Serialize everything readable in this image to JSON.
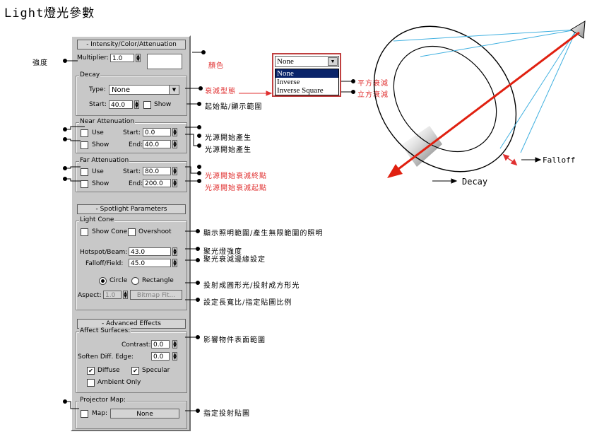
{
  "title": "Light燈光參數",
  "intensity": {
    "rollout": "- Intensity/Color/Attenuation",
    "multiplier_label": "Multiplier:",
    "multiplier_value": "1.0",
    "decay_group": "Decay",
    "type_label": "Type:",
    "type_value": "None",
    "start_label": "Start:",
    "start_value": "40.0",
    "show_label": "Show",
    "near_group": "Near Attenuation",
    "near_use": "Use",
    "near_show": "Show",
    "near_start_label": "Start:",
    "near_start_value": "0.0",
    "near_end_label": "End:",
    "near_end_value": "40.0",
    "far_group": "Far Attenuation",
    "far_use": "Use",
    "far_show": "Show",
    "far_start_label": "Start:",
    "far_start_value": "80.0",
    "far_end_label": "End:",
    "far_end_value": "200.0"
  },
  "spotlight": {
    "rollout": "-    Spotlight Parameters",
    "cone_group": "Light Cone",
    "show_cone": "Show Cone",
    "overshoot": "Overshoot",
    "hotspot_label": "Hotspot/Beam:",
    "hotspot_value": "43.0",
    "falloff_label": "Falloff/Field:",
    "falloff_value": "45.0",
    "circle": "Circle",
    "rectangle": "Rectangle",
    "aspect_label": "Aspect:",
    "aspect_value": "1.0",
    "bitmap_fit": "Bitmap Fit..."
  },
  "advanced": {
    "rollout": "-      Advanced Effects",
    "affect_group": "Affect Surfaces:",
    "contrast_label": "Contrast:",
    "contrast_value": "0.0",
    "soften_label": "Soften Diff. Edge:",
    "soften_value": "0.0",
    "diffuse": "Diffuse",
    "specular": "Specular",
    "ambient_only": "Ambient Only",
    "projector_group": "Projector Map:",
    "map_label": "Map:",
    "map_value": "None"
  },
  "dropdown_popup": {
    "selected": "None",
    "options": [
      "None",
      "Inverse",
      "Inverse Square"
    ]
  },
  "annotations": {
    "intensity": "強度",
    "color": "顏色",
    "decay_type": "衰減型態",
    "square_decay": "平方衰減",
    "cube_decay": "立方衰減",
    "start_show": "起始點/顯示範圍",
    "near_1": "光源開始產生",
    "near_2": "光源開始產生",
    "far_1": "光源開始衰減終點",
    "far_2": "光源開始衰減起點",
    "show_cone": "顯示照明範圍/產生無限範圍的照明",
    "hotspot": "聚光燈強度",
    "falloff": "聚光衰減邊緣設定",
    "circle_rect": "投射成圓形光/投射成方形光",
    "aspect": "設定長寬比/指定貼圖比例",
    "affect": "影響物件表面範圍",
    "projector": "指定投射貼圖"
  },
  "diagram": {
    "falloff_label": "Falloff",
    "decay_label": "Decay",
    "colors": {
      "cone": "#40b0e0",
      "arrow": "#e02010",
      "outline": "#000000"
    }
  }
}
